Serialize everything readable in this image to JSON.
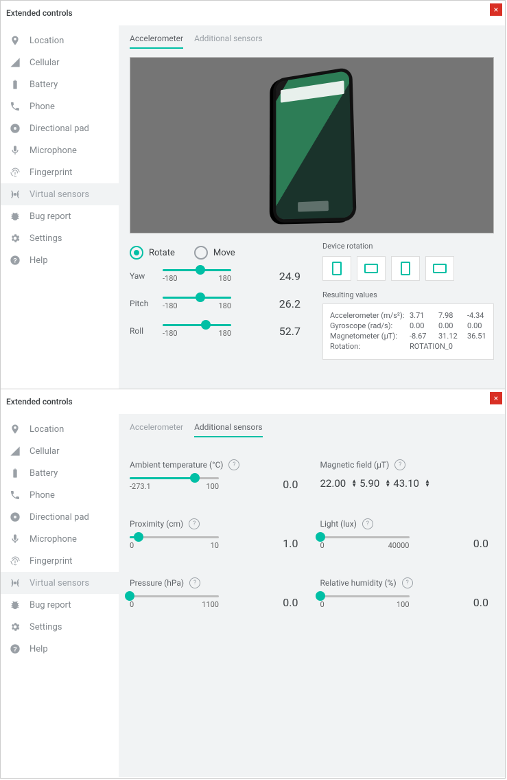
{
  "sidebar": [
    {
      "icon": "location",
      "label": "Location",
      "active": false
    },
    {
      "icon": "cellular",
      "label": "Cellular",
      "active": false
    },
    {
      "icon": "battery",
      "label": "Battery",
      "active": false
    },
    {
      "icon": "phone",
      "label": "Phone",
      "active": false
    },
    {
      "icon": "dpad",
      "label": "Directional pad",
      "active": false
    },
    {
      "icon": "mic",
      "label": "Microphone",
      "active": false
    },
    {
      "icon": "fingerprint",
      "label": "Fingerprint",
      "active": false
    },
    {
      "icon": "sensors",
      "label": "Virtual sensors",
      "active": true
    },
    {
      "icon": "bug",
      "label": "Bug report",
      "active": false
    },
    {
      "icon": "settings",
      "label": "Settings",
      "active": false
    },
    {
      "icon": "help",
      "label": "Help",
      "active": false
    }
  ],
  "p1": {
    "title": "Extended controls",
    "tabs": [
      "Accelerometer",
      "Additional sensors"
    ],
    "mode": {
      "rotate": "Rotate",
      "move": "Move"
    },
    "sliders": [
      {
        "name": "yaw",
        "label": "Yaw",
        "min": "-180",
        "max": "180",
        "value": "24.9",
        "pos": 55
      },
      {
        "name": "pitch",
        "label": "Pitch",
        "min": "-180",
        "max": "180",
        "value": "26.2",
        "pos": 55
      },
      {
        "name": "roll",
        "label": "Roll",
        "min": "-180",
        "max": "180",
        "value": "52.7",
        "pos": 63
      }
    ],
    "deviceRotationLabel": "Device rotation",
    "resultTitle": "Resulting values",
    "results": [
      {
        "label": "Accelerometer (m/s²):",
        "v": [
          "3.71",
          "7.98",
          "-4.34"
        ]
      },
      {
        "label": "Gyroscope (rad/s):",
        "v": [
          "0.00",
          "0.00",
          "0.00"
        ]
      },
      {
        "label": "Magnetometer (μT):",
        "v": [
          "-8.67",
          "31.12",
          "36.51"
        ]
      },
      {
        "label": "Rotation:",
        "v": [
          "ROTATION_0"
        ]
      }
    ]
  },
  "p2": {
    "title": "Extended controls",
    "tabs": [
      "Accelerometer",
      "Additional sensors"
    ],
    "sensors": [
      {
        "name": "ambient-temperature",
        "label": "Ambient temperature (°C)",
        "min": "-273.1",
        "max": "100",
        "value": "0.0",
        "pos": 73,
        "type": "slider"
      },
      {
        "name": "magnetic-field",
        "label": "Magnetic field (μT)",
        "type": "triple",
        "v": [
          "22.00",
          "5.90",
          "43.10"
        ]
      },
      {
        "name": "proximity",
        "label": "Proximity (cm)",
        "min": "0",
        "max": "10",
        "value": "1.0",
        "pos": 10,
        "type": "slider"
      },
      {
        "name": "light",
        "label": "Light (lux)",
        "min": "0",
        "max": "40000",
        "value": "0.0",
        "pos": 0,
        "type": "slider"
      },
      {
        "name": "pressure",
        "label": "Pressure (hPa)",
        "min": "0",
        "max": "1100",
        "value": "0.0",
        "pos": 0,
        "type": "slider"
      },
      {
        "name": "relative-humidity",
        "label": "Relative humidity (%)",
        "min": "0",
        "max": "100",
        "value": "0.0",
        "pos": 0,
        "type": "slider"
      }
    ]
  }
}
